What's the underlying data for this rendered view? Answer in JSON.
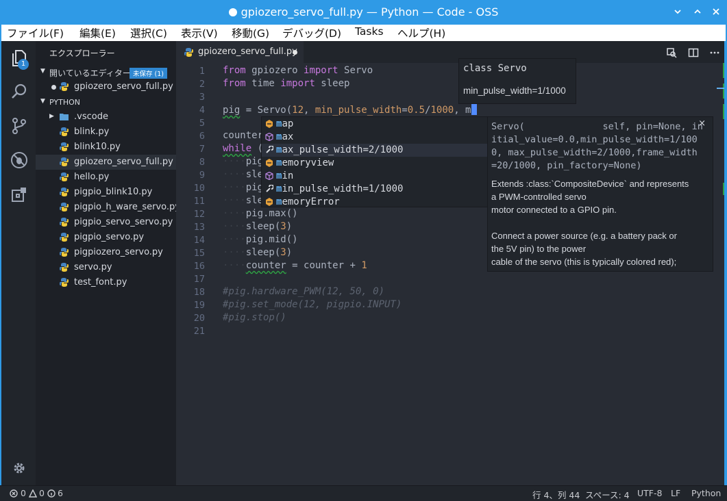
{
  "window": {
    "title": "gpiozero_servo_full.py — Python — Code - OSS"
  },
  "menu": [
    "ファイル(F)",
    "編集(E)",
    "選択(C)",
    "表示(V)",
    "移動(G)",
    "デバッグ(D)",
    "Tasks",
    "ヘルプ(H)"
  ],
  "activity": {
    "badge": "1"
  },
  "sidebar": {
    "header": "エクスプローラー",
    "open_editors": {
      "title": "開いているエディター",
      "badge": "未保存 (1)",
      "file": "gpiozero_servo_full.py"
    },
    "folder": "PYTHON",
    "items": [
      ".vscode",
      "blink.py",
      "blink10.py",
      "gpiozero_servo_full.py",
      "hello.py",
      "pigpio_blink10.py",
      "pigpio_h_ware_servo.py",
      "pigpio_servo_servo.py",
      "pigpio_servo.py",
      "pigpiozero_servo.py",
      "servo.py",
      "test_font.py"
    ]
  },
  "tab": {
    "label": "gpiozero_servo_full.py"
  },
  "editor": {
    "line_numbers": [
      "1",
      "2",
      "3",
      "4",
      "5",
      "6",
      "7",
      "8",
      "9",
      "10",
      "11",
      "12",
      "13",
      "14",
      "15",
      "16",
      "17",
      "18",
      "19",
      "20",
      "21"
    ]
  },
  "hover": {
    "line1": "class Servo",
    "line2": "min_pulse_width=1/1000"
  },
  "suggest": {
    "typed": "m",
    "items": [
      {
        "rest": "ap",
        "kind": "function"
      },
      {
        "rest": "ax",
        "kind": "class"
      },
      {
        "rest": "ax_pulse_width=2/1000",
        "kind": "variable"
      },
      {
        "rest": "emoryview",
        "kind": "function"
      },
      {
        "rest": "in",
        "kind": "class"
      },
      {
        "rest": "in_pulse_width=1/1000",
        "kind": "variable"
      },
      {
        "rest": "emoryError",
        "kind": "function"
      }
    ]
  },
  "details": {
    "signature": "Servo(              self, pin=None, in\nitial_value=0.0,min_pulse_width=1/100\n0, max_pulse_width=2/1000,frame_width\n=20/1000, pin_factory=None)",
    "doc": "Extends :class:`CompositeDevice` and represents\na PWM-controlled servo\nmotor connected to a GPIO pin.\n\nConnect a power source (e.g. a battery pack or\nthe 5V pin) to the power\ncable of the servo (this is typically colored red);",
    "close": "×"
  },
  "status": {
    "errors": "0",
    "warnings": "0",
    "info": "6",
    "position": "行 4、列 44",
    "spaces": "スペース: 4",
    "encoding": "UTF-8",
    "eol": "LF",
    "language": "Python"
  },
  "colors": {
    "accent": "#2f9ae6",
    "editor_bg": "#282c34",
    "keyword": "#c678dd",
    "number": "#d19a66",
    "match": "#61afef"
  }
}
